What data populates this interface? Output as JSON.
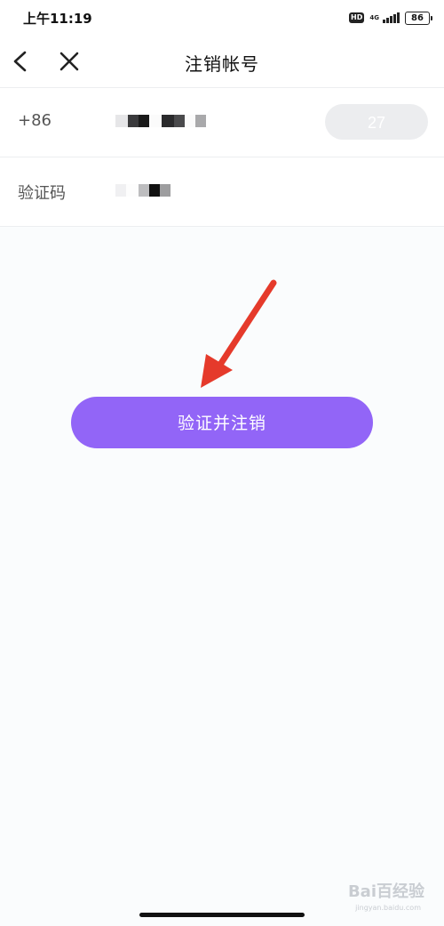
{
  "status_bar": {
    "time": "上午11:19",
    "hd": "HD",
    "network": "4G",
    "battery": "86"
  },
  "nav": {
    "title": "注销帐号"
  },
  "form": {
    "phone_prefix": "+86",
    "get_code_label": "27",
    "code_label": "验证码"
  },
  "submit_label": "验证并注销",
  "colors": {
    "accent": "#9265f7",
    "arrow": "#e53a2b"
  },
  "watermark": {
    "brand": "Bai百经验",
    "url": "jingyan.baidu.com"
  }
}
